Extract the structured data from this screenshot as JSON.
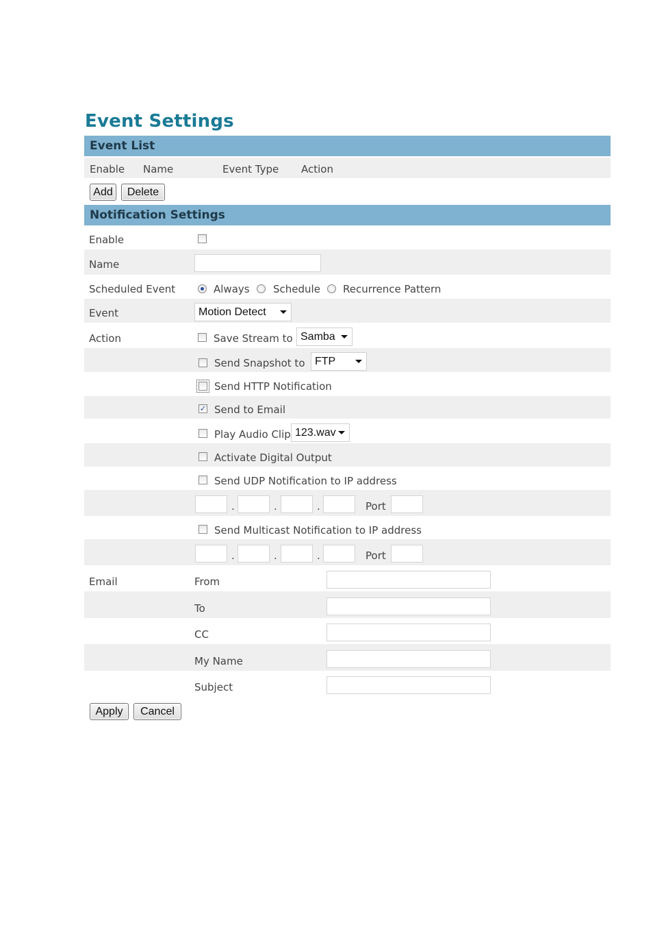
{
  "page_title": "Event Settings",
  "event_list": {
    "header": "Event List",
    "columns": [
      "Enable",
      "Name",
      "Event Type",
      "Action"
    ],
    "add_label": "Add",
    "delete_label": "Delete"
  },
  "notification": {
    "header": "Notification Settings",
    "enable_label": "Enable",
    "enable_checked": false,
    "name_label": "Name",
    "name_value": "",
    "scheduled_label": "Scheduled Event",
    "scheduled_options": [
      "Always",
      "Schedule",
      "Recurrence Pattern"
    ],
    "scheduled_selected": "Always",
    "event_label": "Event",
    "event_value": "Motion Detect",
    "action_label": "Action",
    "actions": {
      "save_stream": {
        "label": "Save Stream to",
        "checked": false,
        "select": "Samba"
      },
      "send_snapshot": {
        "label": "Send Snapshot to",
        "checked": false,
        "select": "FTP"
      },
      "http": {
        "label": "Send HTTP Notification",
        "checked": false
      },
      "email": {
        "label": "Send to Email",
        "checked": true
      },
      "audio": {
        "label": "Play Audio Clip",
        "checked": false,
        "select": "123.wav"
      },
      "digital_output": {
        "label": "Activate Digital Output",
        "checked": false
      },
      "udp": {
        "label": "Send UDP Notification to IP address",
        "checked": false
      },
      "multicast": {
        "label": "Send Multicast Notification to IP address",
        "checked": false
      }
    },
    "ip_dot": ".",
    "port_label": "Port",
    "email_label": "Email",
    "email_fields": [
      "From",
      "To",
      "CC",
      "My Name",
      "Subject"
    ]
  },
  "buttons": {
    "apply": "Apply",
    "cancel": "Cancel"
  },
  "colors": {
    "title": "#1a7a96",
    "section_header": "#7fb2d0",
    "row_shade": "#efefef",
    "check_mark": "#2a4fa0"
  }
}
